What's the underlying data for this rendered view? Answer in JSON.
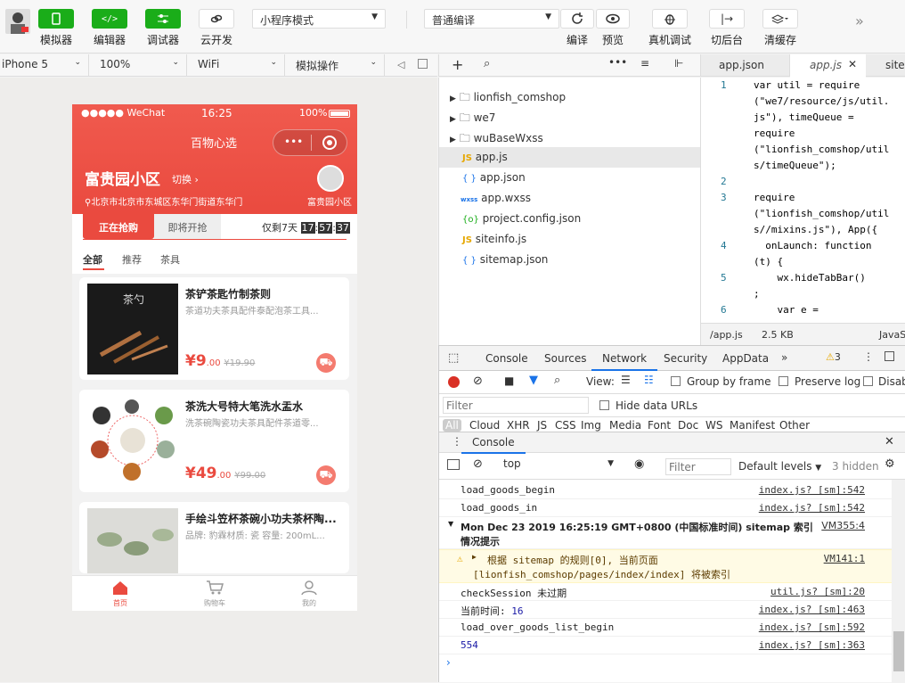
{
  "toolbar": {
    "buttons": [
      {
        "label": "模拟器",
        "icon": "phone-icon",
        "style": "green"
      },
      {
        "label": "编辑器",
        "icon": "code-icon",
        "style": "green"
      },
      {
        "label": "调试器",
        "icon": "sliders-icon",
        "style": "green"
      },
      {
        "label": "云开发",
        "icon": "cloud-link-icon",
        "style": "white"
      }
    ],
    "mode_select": "小程序模式",
    "compile_select": "普通编译",
    "actions": [
      {
        "label": "编译",
        "icon": "refresh-icon"
      },
      {
        "label": "预览",
        "icon": "eye-icon"
      },
      {
        "label": "真机调试",
        "icon": "bug-icon"
      },
      {
        "label": "切后台",
        "icon": "switch-icon"
      },
      {
        "label": "清缓存",
        "icon": "layers-icon"
      }
    ]
  },
  "device_bar": {
    "device": "iPhone 5",
    "zoom": "100%",
    "network": "WiFi",
    "operation": "模拟操作"
  },
  "phone": {
    "status": {
      "carrier": "●●●●● WeChat",
      "time": "16:25",
      "battery": "100%"
    },
    "nav_title": "百物心选",
    "community": {
      "name": "富贵园小区",
      "switch": "切换",
      "address": "北京市北京市东城区东华门街道东华门",
      "leader": "富贵园小区"
    },
    "tabs": {
      "active": "正在抢购",
      "inactive": "即将开抢",
      "countdown_prefix": "仅剩7天",
      "h": "17",
      "m": "57",
      "s": "37"
    },
    "categories": [
      "全部",
      "推荐",
      "茶具"
    ],
    "products": [
      {
        "title": "茶铲茶匙竹制茶则",
        "desc": "茶道功夫茶具配件泰配泡茶工具...",
        "price": "¥9",
        "cents": ".00",
        "orig": "¥19.90"
      },
      {
        "title": "茶洗大号特大笔洗水盂水",
        "desc": "洗茶碗陶瓷功夫茶具配件茶道零...",
        "price": "¥49",
        "cents": ".00",
        "orig": "¥99.00"
      },
      {
        "title": "手绘斗笠杯茶碗小功夫茶杯陶...",
        "desc": "品牌: 豹霖材质: 瓷 容量: 200mL...",
        "price": "",
        "cents": "",
        "orig": ""
      }
    ],
    "tabbar": [
      {
        "label": "首页",
        "icon": "home-icon"
      },
      {
        "label": "购物车",
        "icon": "cart-icon"
      },
      {
        "label": "我的",
        "icon": "user-icon"
      }
    ]
  },
  "files": [
    {
      "name": "lionfish_comshop",
      "type": "folder"
    },
    {
      "name": "we7",
      "type": "folder"
    },
    {
      "name": "wuBaseWxss",
      "type": "folder"
    },
    {
      "name": "app.js",
      "type": "js",
      "active": true
    },
    {
      "name": "app.json",
      "type": "json"
    },
    {
      "name": "app.wxss",
      "type": "wxss"
    },
    {
      "name": "project.config.json",
      "type": "config"
    },
    {
      "name": "siteinfo.js",
      "type": "js"
    },
    {
      "name": "sitemap.json",
      "type": "json"
    }
  ],
  "editor": {
    "tabs": [
      "app.json",
      "app.js",
      "site"
    ],
    "lines": [
      {
        "n": "1",
        "text": "var util = require"
      },
      {
        "n": "",
        "text": "(\"we7/resource/js/util."
      },
      {
        "n": "",
        "text": "js\"), timeQueue ="
      },
      {
        "n": "",
        "text": "require"
      },
      {
        "n": "",
        "text": "(\"lionfish_comshop/util"
      },
      {
        "n": "",
        "text": "s/timeQueue\");"
      },
      {
        "n": "2",
        "text": ""
      },
      {
        "n": "3",
        "text": "require"
      },
      {
        "n": "",
        "text": "(\"lionfish_comshop/util"
      },
      {
        "n": "",
        "text": "s//mixins.js\"), App({"
      },
      {
        "n": "4",
        "text": "  onLaunch: function"
      },
      {
        "n": "",
        "text": "(t) {"
      },
      {
        "n": "5",
        "text": "    wx.hideTabBar()"
      },
      {
        "n": "",
        "text": ";"
      },
      {
        "n": "6",
        "text": "    var e ="
      }
    ],
    "status": {
      "path": "/app.js",
      "size": "2.5 KB",
      "lang": "JavaS"
    }
  },
  "devtools": {
    "tabs": [
      "Console",
      "Sources",
      "Network",
      "Security",
      "AppData"
    ],
    "active_tab": "Network",
    "warn_count": "3",
    "network": {
      "view": "View:",
      "group_by_frame": "Group by frame",
      "preserve_log": "Preserve log",
      "disable": "Disab",
      "filter_placeholder": "Filter",
      "hide_data_urls": "Hide data URLs",
      "types": [
        "All",
        "Cloud",
        "XHR",
        "JS",
        "CSS",
        "Img",
        "Media",
        "Font",
        "Doc",
        "WS",
        "Manifest",
        "Other"
      ]
    },
    "console": {
      "title": "Console",
      "context": "top",
      "filter_placeholder": "Filter",
      "levels": "Default levels",
      "hidden": "3 hidden",
      "rows": [
        {
          "text": "load_goods_begin",
          "src": "index.js? [sm]:542"
        },
        {
          "text": "load_goods_in",
          "src": "index.js? [sm]:542"
        },
        {
          "text": "Mon Dec 23 2019 16:25:19 GMT+0800 (中国标准时间) sitemap 索引",
          "text2": "情况提示",
          "src": "VM355:4"
        },
        {
          "text": "根据 sitemap 的规则[0], 当前页面",
          "text2": "[lionfish_comshop/pages/index/index] 将被索引",
          "src": "VM141:1"
        },
        {
          "text": "checkSession 未过期",
          "src": "util.js? [sm]:20"
        },
        {
          "text": "当前时间:",
          "num": "16",
          "src": "index.js? [sm]:463"
        },
        {
          "text": "load_over_goods_list_begin",
          "src": "index.js? [sm]:592"
        },
        {
          "text": "",
          "num": "554",
          "src": "index.js? [sm]:363"
        }
      ]
    }
  },
  "colors": {
    "green": "#1aad19",
    "red": "#ea4a3f",
    "link_blue": "#1a73e8"
  }
}
